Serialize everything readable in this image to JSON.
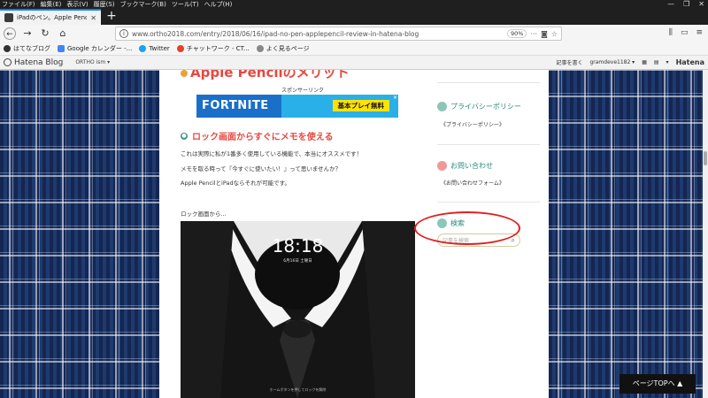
{
  "browser": {
    "menu": [
      "ファイル(F)",
      "編集(E)",
      "表示(V)",
      "履歴(S)",
      "ブックマーク(B)",
      "ツール(T)",
      "ヘルプ(H)"
    ],
    "window_controls": [
      "—",
      "❐",
      "✕"
    ],
    "tab_title": "iPadのペン。Apple Pencil今更",
    "new_tab": "+",
    "url": "www.ortho2018.com/entry/2018/06/16/ipad-no-pen-applepencil-review-in-hatena-blog",
    "zoom": "90%",
    "bookmarks": [
      "はてなブログ",
      "Google カレンダー -...",
      "Twitter",
      "チャットワーク - CT...",
      "よく見るページ"
    ]
  },
  "hatena_bar": {
    "logo": "Hatena Blog",
    "user": "ORTHO ism ▾",
    "right_text": "記事を書く",
    "user_name": "gramdeve1182 ▾",
    "brand": "Hatena"
  },
  "article": {
    "heading": "Apple Pencilのメリット",
    "ad_label": "スポンサーリンク",
    "ad_title": "FORTNITE",
    "ad_cta": "基本プレイ無料",
    "sub_heading": "ロック画面からすぐにメモを使える",
    "paragraphs": [
      "これは実際に私が1番多く使用している機能で、本当にオススメです！",
      "メモを取る時って『今すぐに使いたい！』って思いませんか？",
      "Apple PencilとiPadならそれが可能です。"
    ],
    "caption": "ロック画面から...",
    "ipad": {
      "status_left": "iPad ✈",
      "status_right": "100%",
      "time": "18:18",
      "date": "6月16日 土曜日",
      "bottom_text": "ホームボタンを押してロックを解除"
    }
  },
  "sidebar": {
    "privacy_heading": "プライバシーポリシー",
    "privacy_link": "《プライバシーポリシー》",
    "contact_heading": "お問い合わせ",
    "contact_link": "《お問い合わせフォーム》",
    "search_heading": "検索",
    "search_placeholder": "記事を検索"
  },
  "page_top": "ページTOPへ ▲"
}
